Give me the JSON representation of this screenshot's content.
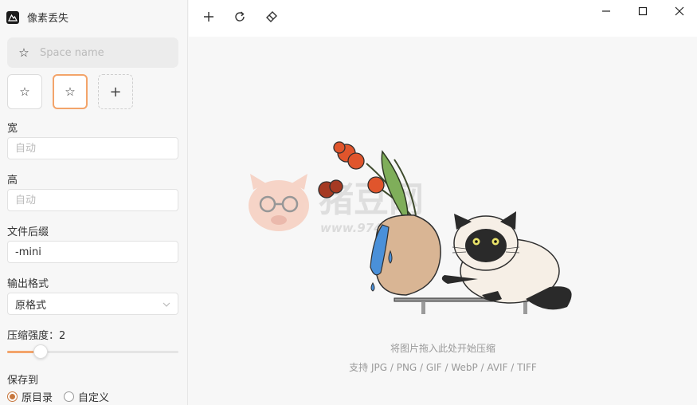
{
  "app": {
    "title": "像素丢失"
  },
  "space": {
    "placeholder": "Space name"
  },
  "space_buttons": {
    "icons": [
      "star-icon",
      "star-icon",
      "plus-icon"
    ]
  },
  "form": {
    "width_label": "宽",
    "width_placeholder": "自动",
    "height_label": "高",
    "height_placeholder": "自动",
    "suffix_label": "文件后缀",
    "suffix_value": "-mini",
    "format_label": "输出格式",
    "format_value": "原格式",
    "strength_label": "压缩强度：",
    "strength_value": "2",
    "strength_fraction": 0.16,
    "save_label": "保存到",
    "save_options": [
      "原目录",
      "自定义"
    ],
    "save_selected": "原目录"
  },
  "toolbar": {
    "icons": [
      "plus-icon",
      "refresh-icon",
      "eraser-icon"
    ]
  },
  "window": {
    "controls": [
      "minimize-icon",
      "maximize-icon",
      "close-icon"
    ]
  },
  "dropzone": {
    "hint": "将图片拖入此处开始压缩",
    "formats": "支持 JPG / PNG / GIF / WebP / AVIF / TIFF"
  },
  "watermark": {
    "text": "猪豆网",
    "url": "www.97444.cn"
  },
  "colors": {
    "accent": "#f3a46a",
    "radio": "#c7773e"
  }
}
